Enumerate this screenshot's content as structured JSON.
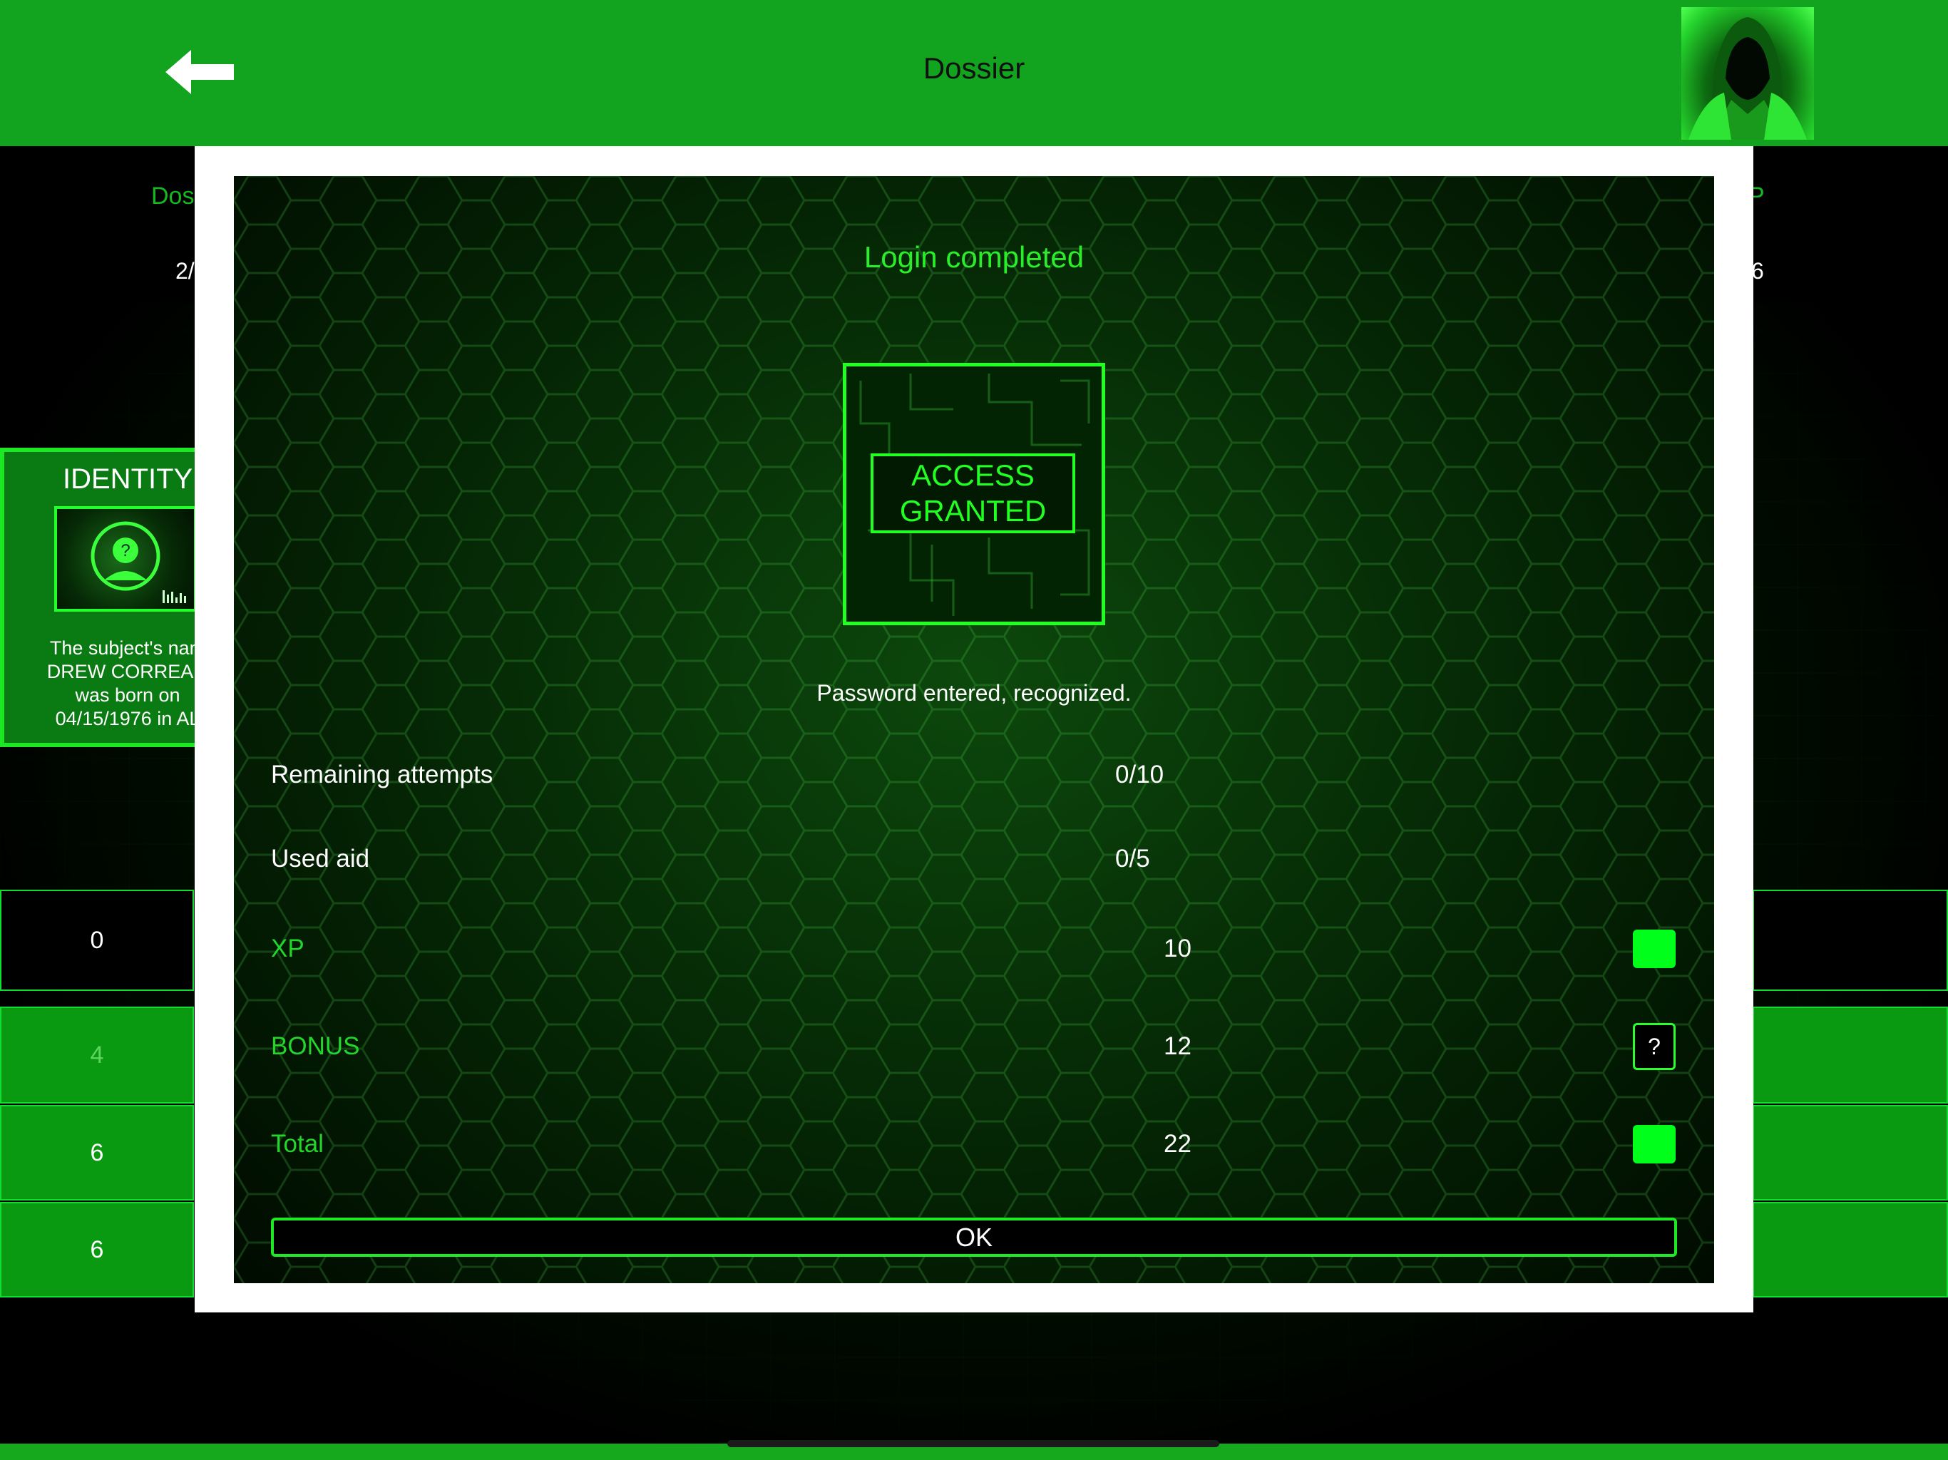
{
  "header": {
    "title": "Dossier"
  },
  "background_page": {
    "top_left_label": "Dos",
    "top_left_value": "2/",
    "top_right_label": "P",
    "top_right_value": "6",
    "identity": {
      "title": "IDENTITY",
      "text_lines": [
        "The subject's nam",
        "DREW CORREA a",
        "was born on",
        "04/15/1976 in AL"
      ]
    },
    "side_cells": [
      "0",
      "4",
      "6",
      "6"
    ]
  },
  "modal": {
    "title": "Login completed",
    "badge_line1": "ACCESS",
    "badge_line2": "GRANTED",
    "message": "Password entered, recognized.",
    "rows": [
      {
        "label": "Remaining attempts",
        "value": "0/10"
      },
      {
        "label": "Used aid",
        "value": "0/5"
      },
      {
        "label": "XP",
        "value": "10"
      },
      {
        "label": "BONUS",
        "value": "12",
        "indicator": "?"
      },
      {
        "label": "Total",
        "value": "22"
      }
    ],
    "ok_label": "OK"
  },
  "colors": {
    "header_green": "#13a41f",
    "accent_green": "#22ff22",
    "indicator_green": "#00ff1a"
  },
  "icons": {
    "back": "arrow-left-icon",
    "avatar": "hooded-hacker-avatar",
    "identity": "question-person-icon"
  }
}
